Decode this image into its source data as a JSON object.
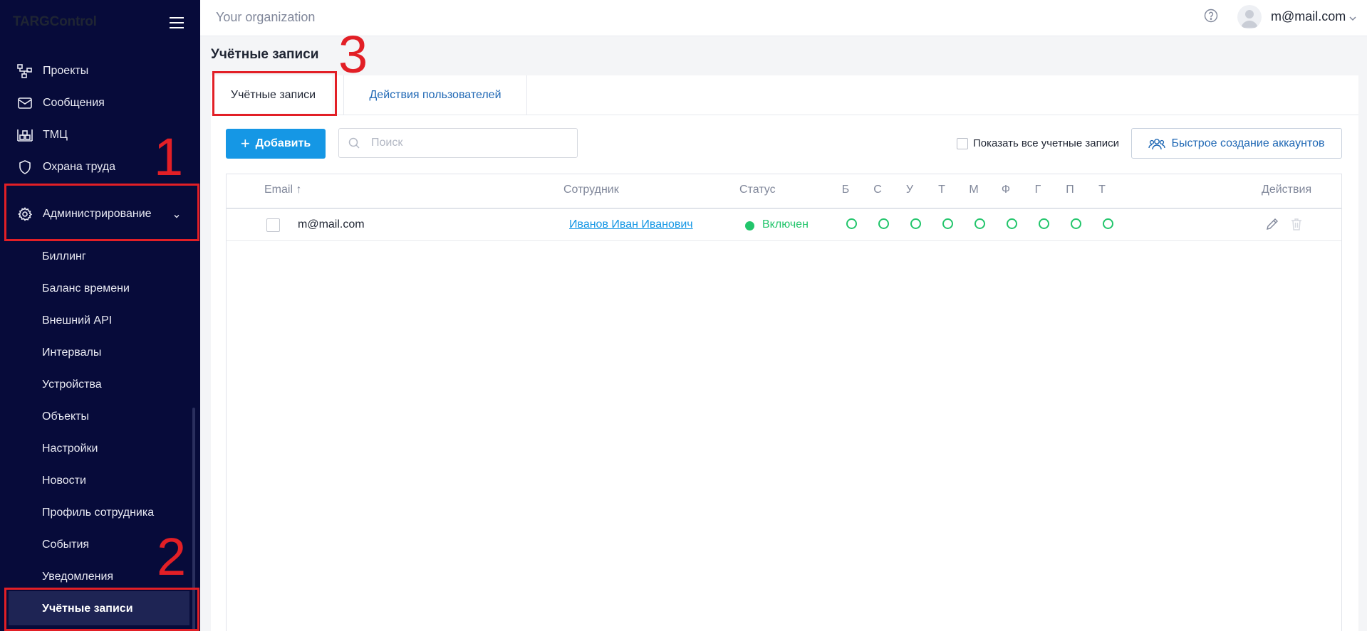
{
  "app": {
    "brand": "TARGControl"
  },
  "sidebar": {
    "items": [
      {
        "label": "Проекты",
        "icon": "projects-icon"
      },
      {
        "label": "Сообщения",
        "icon": "mail-icon"
      },
      {
        "label": "ТМЦ",
        "icon": "warehouse-icon"
      },
      {
        "label": "Охрана труда",
        "icon": "shield-icon"
      },
      {
        "label": "Администрирование",
        "icon": "gear-icon"
      }
    ],
    "admin_items": [
      {
        "label": "Биллинг"
      },
      {
        "label": "Баланс времени"
      },
      {
        "label": "Внешний API"
      },
      {
        "label": "Интервалы"
      },
      {
        "label": "Устройства"
      },
      {
        "label": "Объекты"
      },
      {
        "label": "Настройки"
      },
      {
        "label": "Новости"
      },
      {
        "label": "Профиль сотрудника"
      },
      {
        "label": "События"
      },
      {
        "label": "Уведомления"
      },
      {
        "label": "Учётные записи"
      }
    ]
  },
  "annotations": [
    "1",
    "2",
    "3"
  ],
  "header": {
    "organization": "Your organization",
    "user_email": "m@mail.com"
  },
  "page": {
    "title": "Учётные записи",
    "tabs": [
      {
        "label": "Учётные записи",
        "active": true
      },
      {
        "label": "Действия пользователей",
        "active": false
      }
    ]
  },
  "toolbar": {
    "add_label": "Добавить",
    "search_placeholder": "Поиск",
    "show_all_label": "Показать все учетные записи",
    "quick_create_label": "Быстрое создание аккаунтов"
  },
  "table": {
    "columns": {
      "email": "Email ↑",
      "employee": "Сотрудник",
      "status": "Статус",
      "actions": "Действия"
    },
    "day_columns": [
      "Б",
      "С",
      "У",
      "Т",
      "М",
      "Ф",
      "Г",
      "П",
      "Т"
    ],
    "rows": [
      {
        "email": "m@mail.com",
        "employee": "Иванов Иван Иванович",
        "status": "Включен"
      }
    ]
  },
  "colors": {
    "sidebar_bg": "#070b3a",
    "accent_blue": "#1597e5",
    "link_blue": "#1e67b4",
    "status_green": "#22c56b",
    "annotation_red": "#e21f26"
  }
}
